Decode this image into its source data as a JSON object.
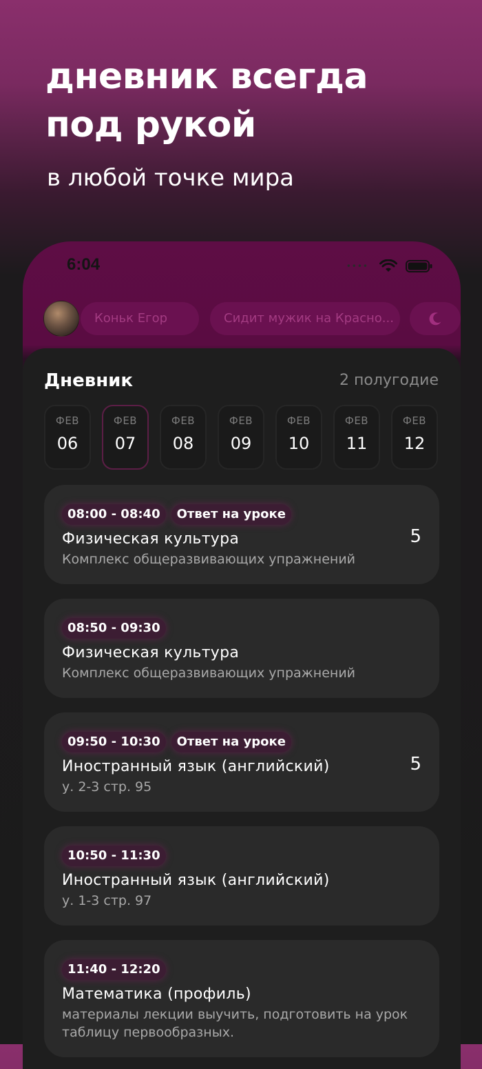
{
  "promo": {
    "title_line1": "дневник всегда",
    "title_line2": "под рукой",
    "subtitle": "в любой точке мира"
  },
  "status_bar": {
    "time": "6:04"
  },
  "user_bar": {
    "user_name": "Коньк Егор",
    "status_text": "Сидит мужик на Красно...",
    "theme_icon": "moon-icon"
  },
  "diary": {
    "title": "Дневник",
    "term": "2 полугодие",
    "dates": [
      {
        "month": "ФЕВ",
        "day": "06",
        "selected": false
      },
      {
        "month": "ФЕВ",
        "day": "07",
        "selected": true
      },
      {
        "month": "ФЕВ",
        "day": "08",
        "selected": false
      },
      {
        "month": "ФЕВ",
        "day": "09",
        "selected": false
      },
      {
        "month": "ФЕВ",
        "day": "10",
        "selected": false
      },
      {
        "month": "ФЕВ",
        "day": "11",
        "selected": false
      },
      {
        "month": "ФЕВ",
        "day": "12",
        "selected": false
      }
    ],
    "lessons": [
      {
        "time": "08:00 - 08:40",
        "badge": "Ответ на уроке",
        "subject": "Физическая культура",
        "homework": "Комплекс общеразвивающих упражнений",
        "grade": "5"
      },
      {
        "time": "08:50 - 09:30",
        "badge": "",
        "subject": "Физическая культура",
        "homework": "Комплекс общеразвивающих упражнений",
        "grade": ""
      },
      {
        "time": "09:50 - 10:30",
        "badge": "Ответ на уроке",
        "subject": "Иностранный язык (английский)",
        "homework": "у. 2-3 стр. 95",
        "grade": "5"
      },
      {
        "time": "10:50 - 11:30",
        "badge": "",
        "subject": "Иностранный язык (английский)",
        "homework": "у. 1-3 стр. 97",
        "grade": ""
      },
      {
        "time": "11:40 - 12:20",
        "badge": "",
        "subject": "Математика (профиль)",
        "homework": "материалы лекции выучить, подготовить на урок таблицу первообразных.",
        "grade": ""
      }
    ]
  },
  "colors": {
    "accent": "#8a2f6c",
    "header_bg": "#5e0d45",
    "card_bg": "#2a2a2a",
    "tag_bg": "#3c1d33"
  }
}
